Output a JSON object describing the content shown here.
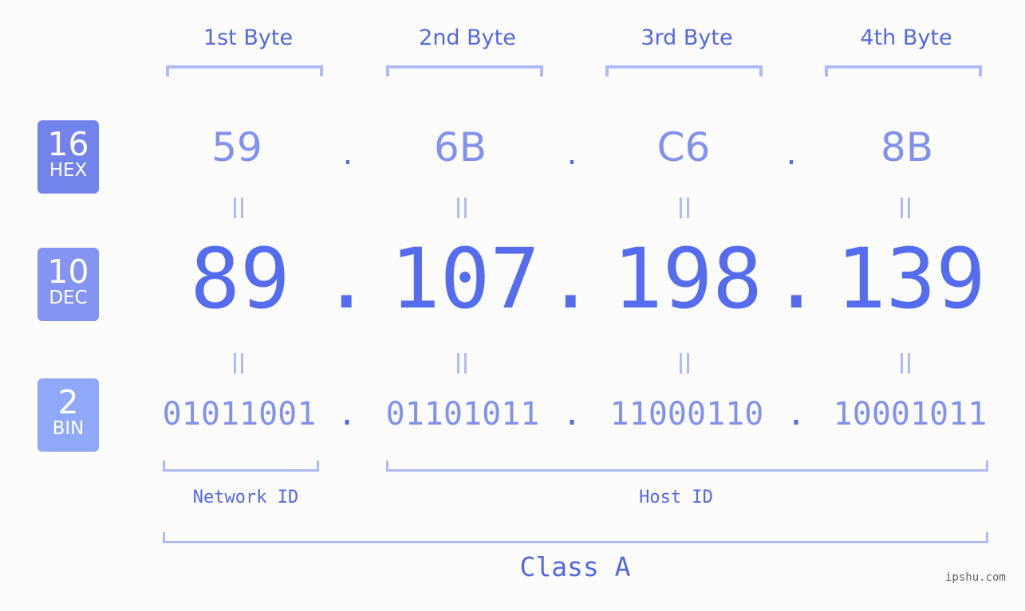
{
  "bytes": [
    {
      "label": "1st Byte",
      "hex": "59",
      "dec": "89",
      "bin": "01011001"
    },
    {
      "label": "2nd Byte",
      "hex": "6B",
      "dec": "107",
      "bin": "01101011"
    },
    {
      "label": "3rd Byte",
      "hex": "C6",
      "dec": "198",
      "bin": "11000110"
    },
    {
      "label": "4th Byte",
      "hex": "8B",
      "dec": "139",
      "bin": "10001011"
    }
  ],
  "separator": ".",
  "badges": {
    "hex": {
      "base": "16",
      "name": "HEX",
      "color": "#7383ec"
    },
    "dec": {
      "base": "10",
      "name": "DEC",
      "color": "#8494f2"
    },
    "bin": {
      "base": "2",
      "name": "BIN",
      "color": "#8fa8f8"
    }
  },
  "network_id_label": "Network ID",
  "host_id_label": "Host ID",
  "class_label": "Class A",
  "watermark": "ipshu.com",
  "colors": {
    "accent": "#5468e0",
    "light_text": "#8391ee",
    "bracket": "#b1bbf8",
    "background": "#fbfcfb"
  }
}
